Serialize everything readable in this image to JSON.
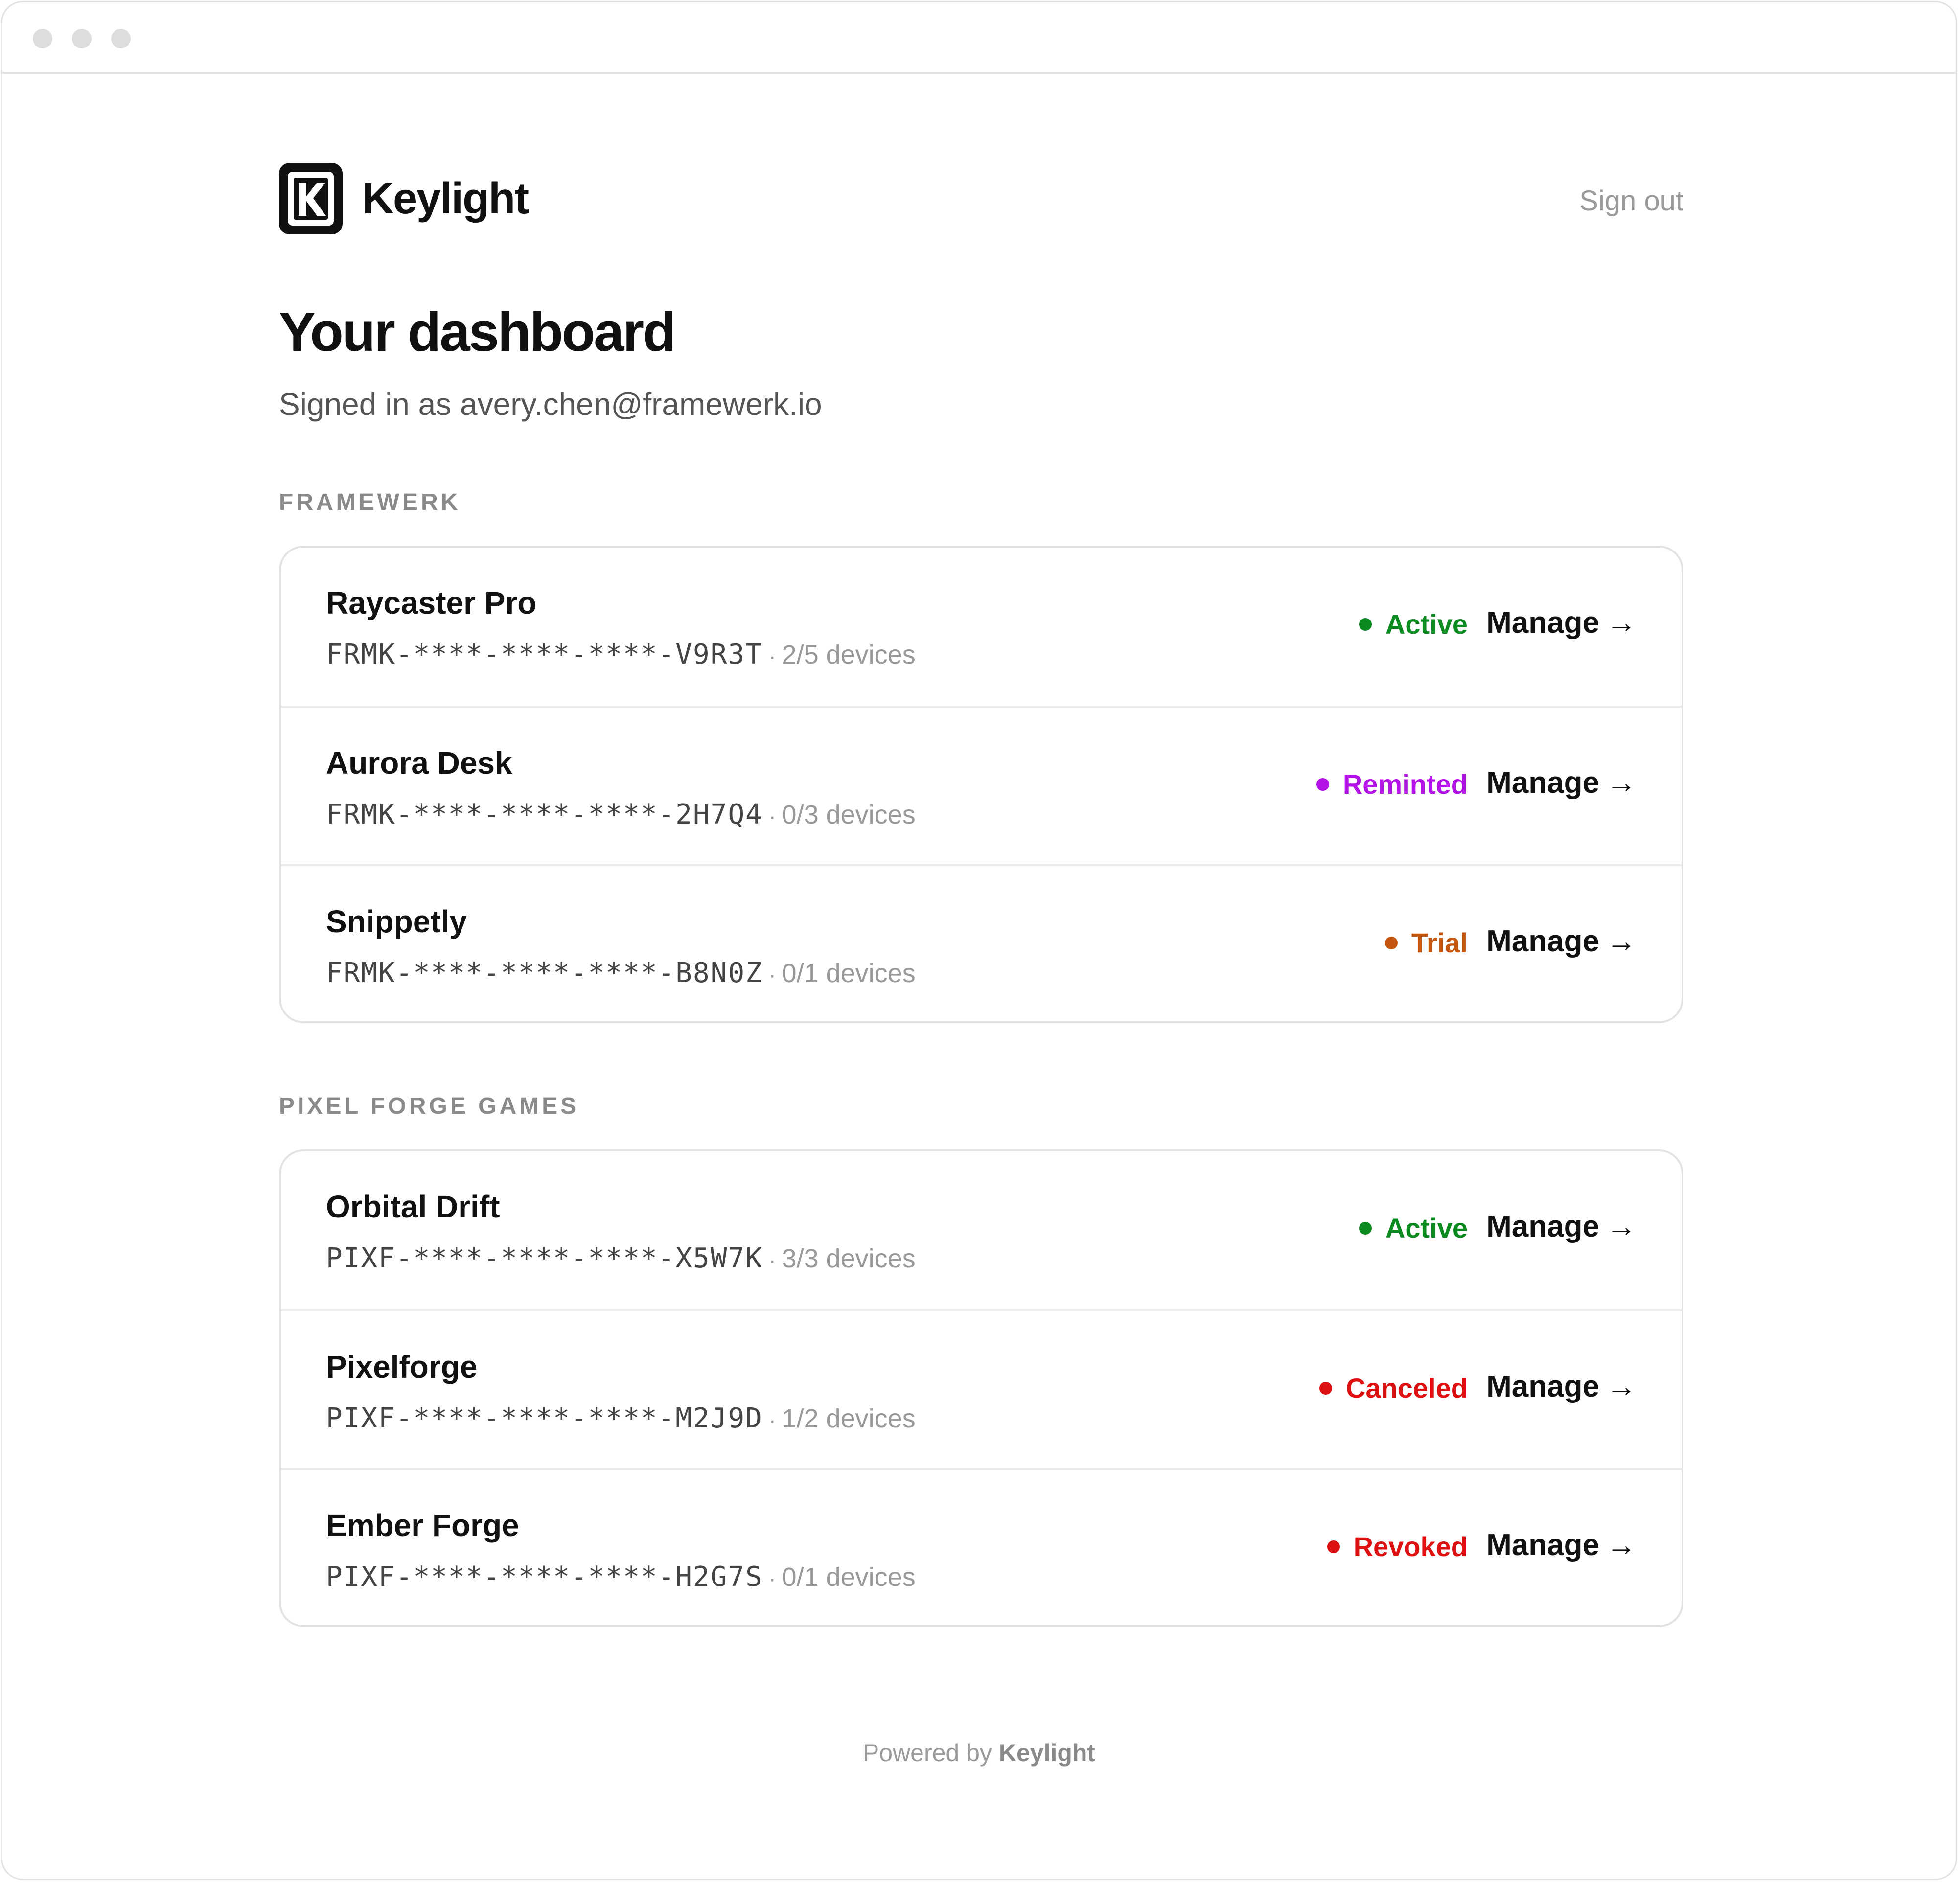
{
  "brand": {
    "name": "Keylight",
    "logo_icon": "keylight-logo-icon"
  },
  "header": {
    "sign_out_label": "Sign out"
  },
  "page": {
    "title": "Your dashboard",
    "signed_in_text": "Signed in as avery.chen@framewerk.io"
  },
  "groups": [
    {
      "label": "FRAMEWERK",
      "licenses": [
        {
          "name": "Raycaster Pro",
          "key": "FRMK-****-****-****-V9R3T",
          "separator": "·",
          "devices": "2/5 devices",
          "status": "Active",
          "status_color": "#0a8a1f",
          "manage_label": "Manage",
          "manage_arrow": "→"
        },
        {
          "name": "Aurora Desk",
          "key": "FRMK-****-****-****-2H7Q4",
          "separator": "·",
          "devices": "0/3 devices",
          "status": "Reminted",
          "status_color": "#b312e6",
          "manage_label": "Manage",
          "manage_arrow": "→"
        },
        {
          "name": "Snippetly",
          "key": "FRMK-****-****-****-B8N0Z",
          "separator": "·",
          "devices": "0/1 devices",
          "status": "Trial",
          "status_color": "#c4560f",
          "manage_label": "Manage",
          "manage_arrow": "→"
        }
      ]
    },
    {
      "label": "PIXEL FORGE GAMES",
      "licenses": [
        {
          "name": "Orbital Drift",
          "key": "PIXF-****-****-****-X5W7K",
          "separator": "·",
          "devices": "3/3 devices",
          "status": "Active",
          "status_color": "#0a8a1f",
          "manage_label": "Manage",
          "manage_arrow": "→"
        },
        {
          "name": "Pixelforge",
          "key": "PIXF-****-****-****-M2J9D",
          "separator": "·",
          "devices": "1/2 devices",
          "status": "Canceled",
          "status_color": "#dd1111",
          "manage_label": "Manage",
          "manage_arrow": "→"
        },
        {
          "name": "Ember Forge",
          "key": "PIXF-****-****-****-H2G7S",
          "separator": "·",
          "devices": "0/1 devices",
          "status": "Revoked",
          "status_color": "#dd1111",
          "manage_label": "Manage",
          "manage_arrow": "→"
        }
      ]
    }
  ],
  "footer": {
    "prefix": "Powered by",
    "brand": "Keylight"
  }
}
